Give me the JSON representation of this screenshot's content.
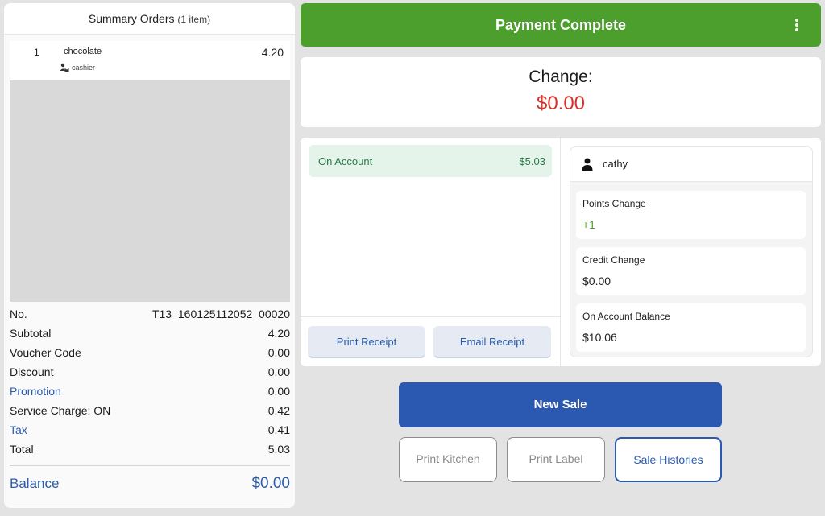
{
  "summary": {
    "title": "Summary Orders",
    "count": "(1 item)",
    "items": [
      {
        "qty": "1",
        "name": "chocolate",
        "price": "4.20",
        "staff": "cashier"
      }
    ],
    "rows": [
      {
        "label": "No.",
        "value": "T13_160125112052_00020"
      },
      {
        "label": "Subtotal",
        "value": "4.20"
      },
      {
        "label": "Voucher Code",
        "value": "0.00"
      },
      {
        "label": "Discount",
        "value": "0.00"
      },
      {
        "label": "Promotion",
        "value": "0.00"
      },
      {
        "label": "Service Charge: ON",
        "value": "0.42"
      },
      {
        "label": "Tax",
        "value": "0.41"
      },
      {
        "label": "Total",
        "value": "5.03"
      }
    ],
    "balance_label": "Balance",
    "balance_value": "$0.00"
  },
  "header": {
    "title": "Payment Complete",
    "menu_icon": "more-vertical-icon",
    "color": "#4c9e2d"
  },
  "change": {
    "label": "Change:",
    "value": "$0.00",
    "color": "#d8322b"
  },
  "payment": {
    "method": "On Account",
    "amount": "$5.03",
    "print_receipt": "Print Receipt",
    "email_receipt": "Email Receipt"
  },
  "customer": {
    "name": "cathy",
    "points_label": "Points Change",
    "points_value": "+1",
    "credit_label": "Credit Change",
    "credit_value": "$0.00",
    "account_label": "On Account Balance",
    "account_value": "$10.06"
  },
  "actions": {
    "new_sale": "New Sale",
    "print_kitchen": "Print Kitchen",
    "print_label": "Print Label",
    "sale_histories": "Sale Histories",
    "accent": "#2b58b0"
  }
}
